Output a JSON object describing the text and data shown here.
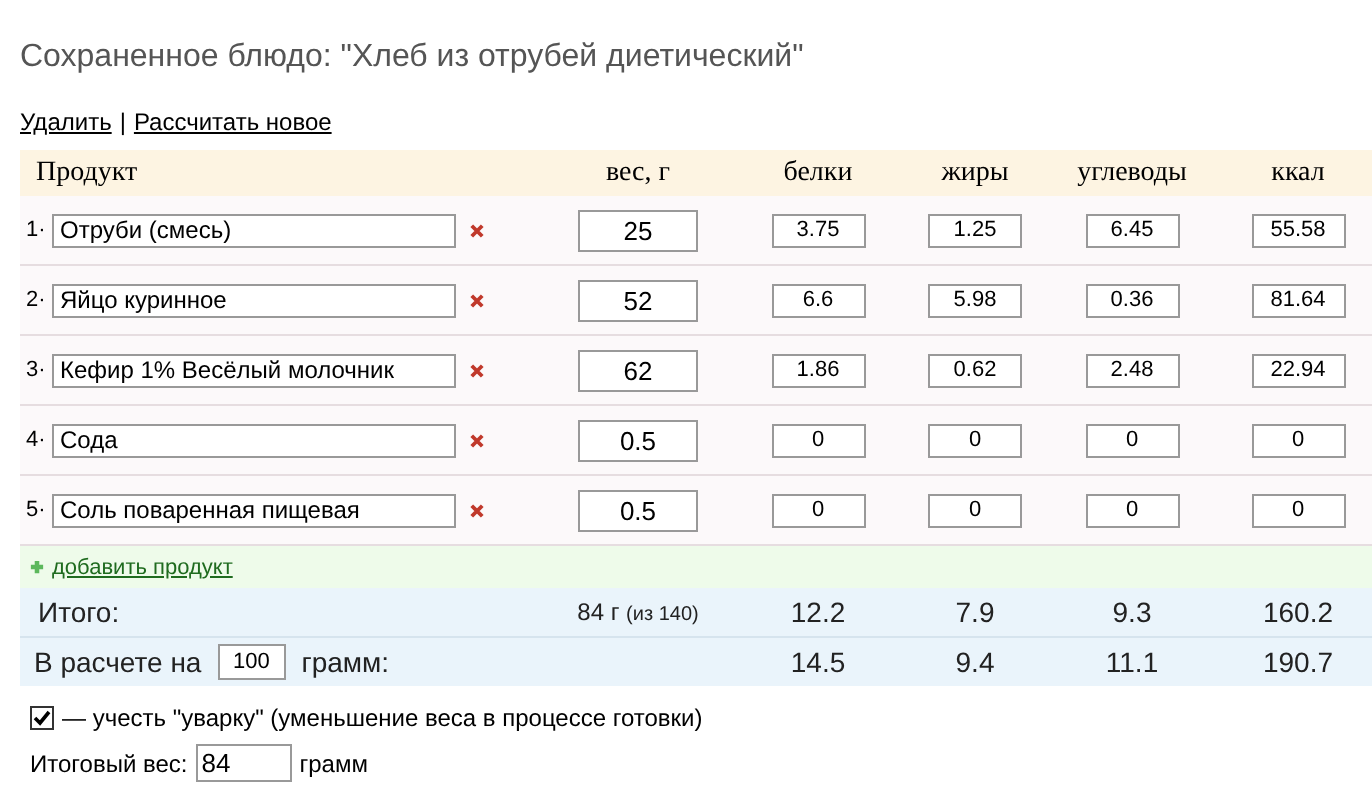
{
  "title": "Сохраненное блюдо: \"Хлеб из отрубей диетический\"",
  "links": [
    "Удалить",
    "Рассчитать новое"
  ],
  "link_separator": "|",
  "columns": [
    "Продукт",
    "вес, г",
    "белки",
    "жиры",
    "углеводы",
    "ккал"
  ],
  "rows": [
    {
      "number": "1·",
      "name": "Отруби (смесь)",
      "weight": "25",
      "protein": "3.75",
      "fat": "1.25",
      "carbs": "6.45",
      "kcal": "55.58"
    },
    {
      "number": "2·",
      "name": "Яйцо куринное",
      "weight": "52",
      "protein": "6.6",
      "fat": "5.98",
      "carbs": "0.36",
      "kcal": "81.64"
    },
    {
      "number": "3·",
      "name": "Кефир 1% Весёлый молочник",
      "weight": "62",
      "protein": "1.86",
      "fat": "0.62",
      "carbs": "2.48",
      "kcal": "22.94"
    },
    {
      "number": "4·",
      "name": "Сода",
      "weight": "0.5",
      "protein": "0",
      "fat": "0",
      "carbs": "0",
      "kcal": "0"
    },
    {
      "number": "5·",
      "name": "Соль поваренная пищевая",
      "weight": "0.5",
      "protein": "0",
      "fat": "0",
      "carbs": "0",
      "kcal": "0"
    }
  ],
  "add_link": "добавить продукт",
  "totals": {
    "label": "Итого:",
    "weight": "84 г",
    "weight_note": "(из 140)",
    "values": [
      "12.2",
      "7.9",
      "9.3",
      "160.2"
    ]
  },
  "per_amount": {
    "label_before": "В расчете на",
    "amount": "100",
    "label_after": "грамм:",
    "values": [
      "14.5",
      "9.4",
      "11.1",
      "190.7"
    ]
  },
  "boil_option": {
    "checked": true,
    "label": "— учесть \"уварку\" (уменьшение веса в процессе готовки)"
  },
  "final_weight": {
    "label": "Итоговый вес:",
    "value": "84",
    "unit": "грамм"
  }
}
